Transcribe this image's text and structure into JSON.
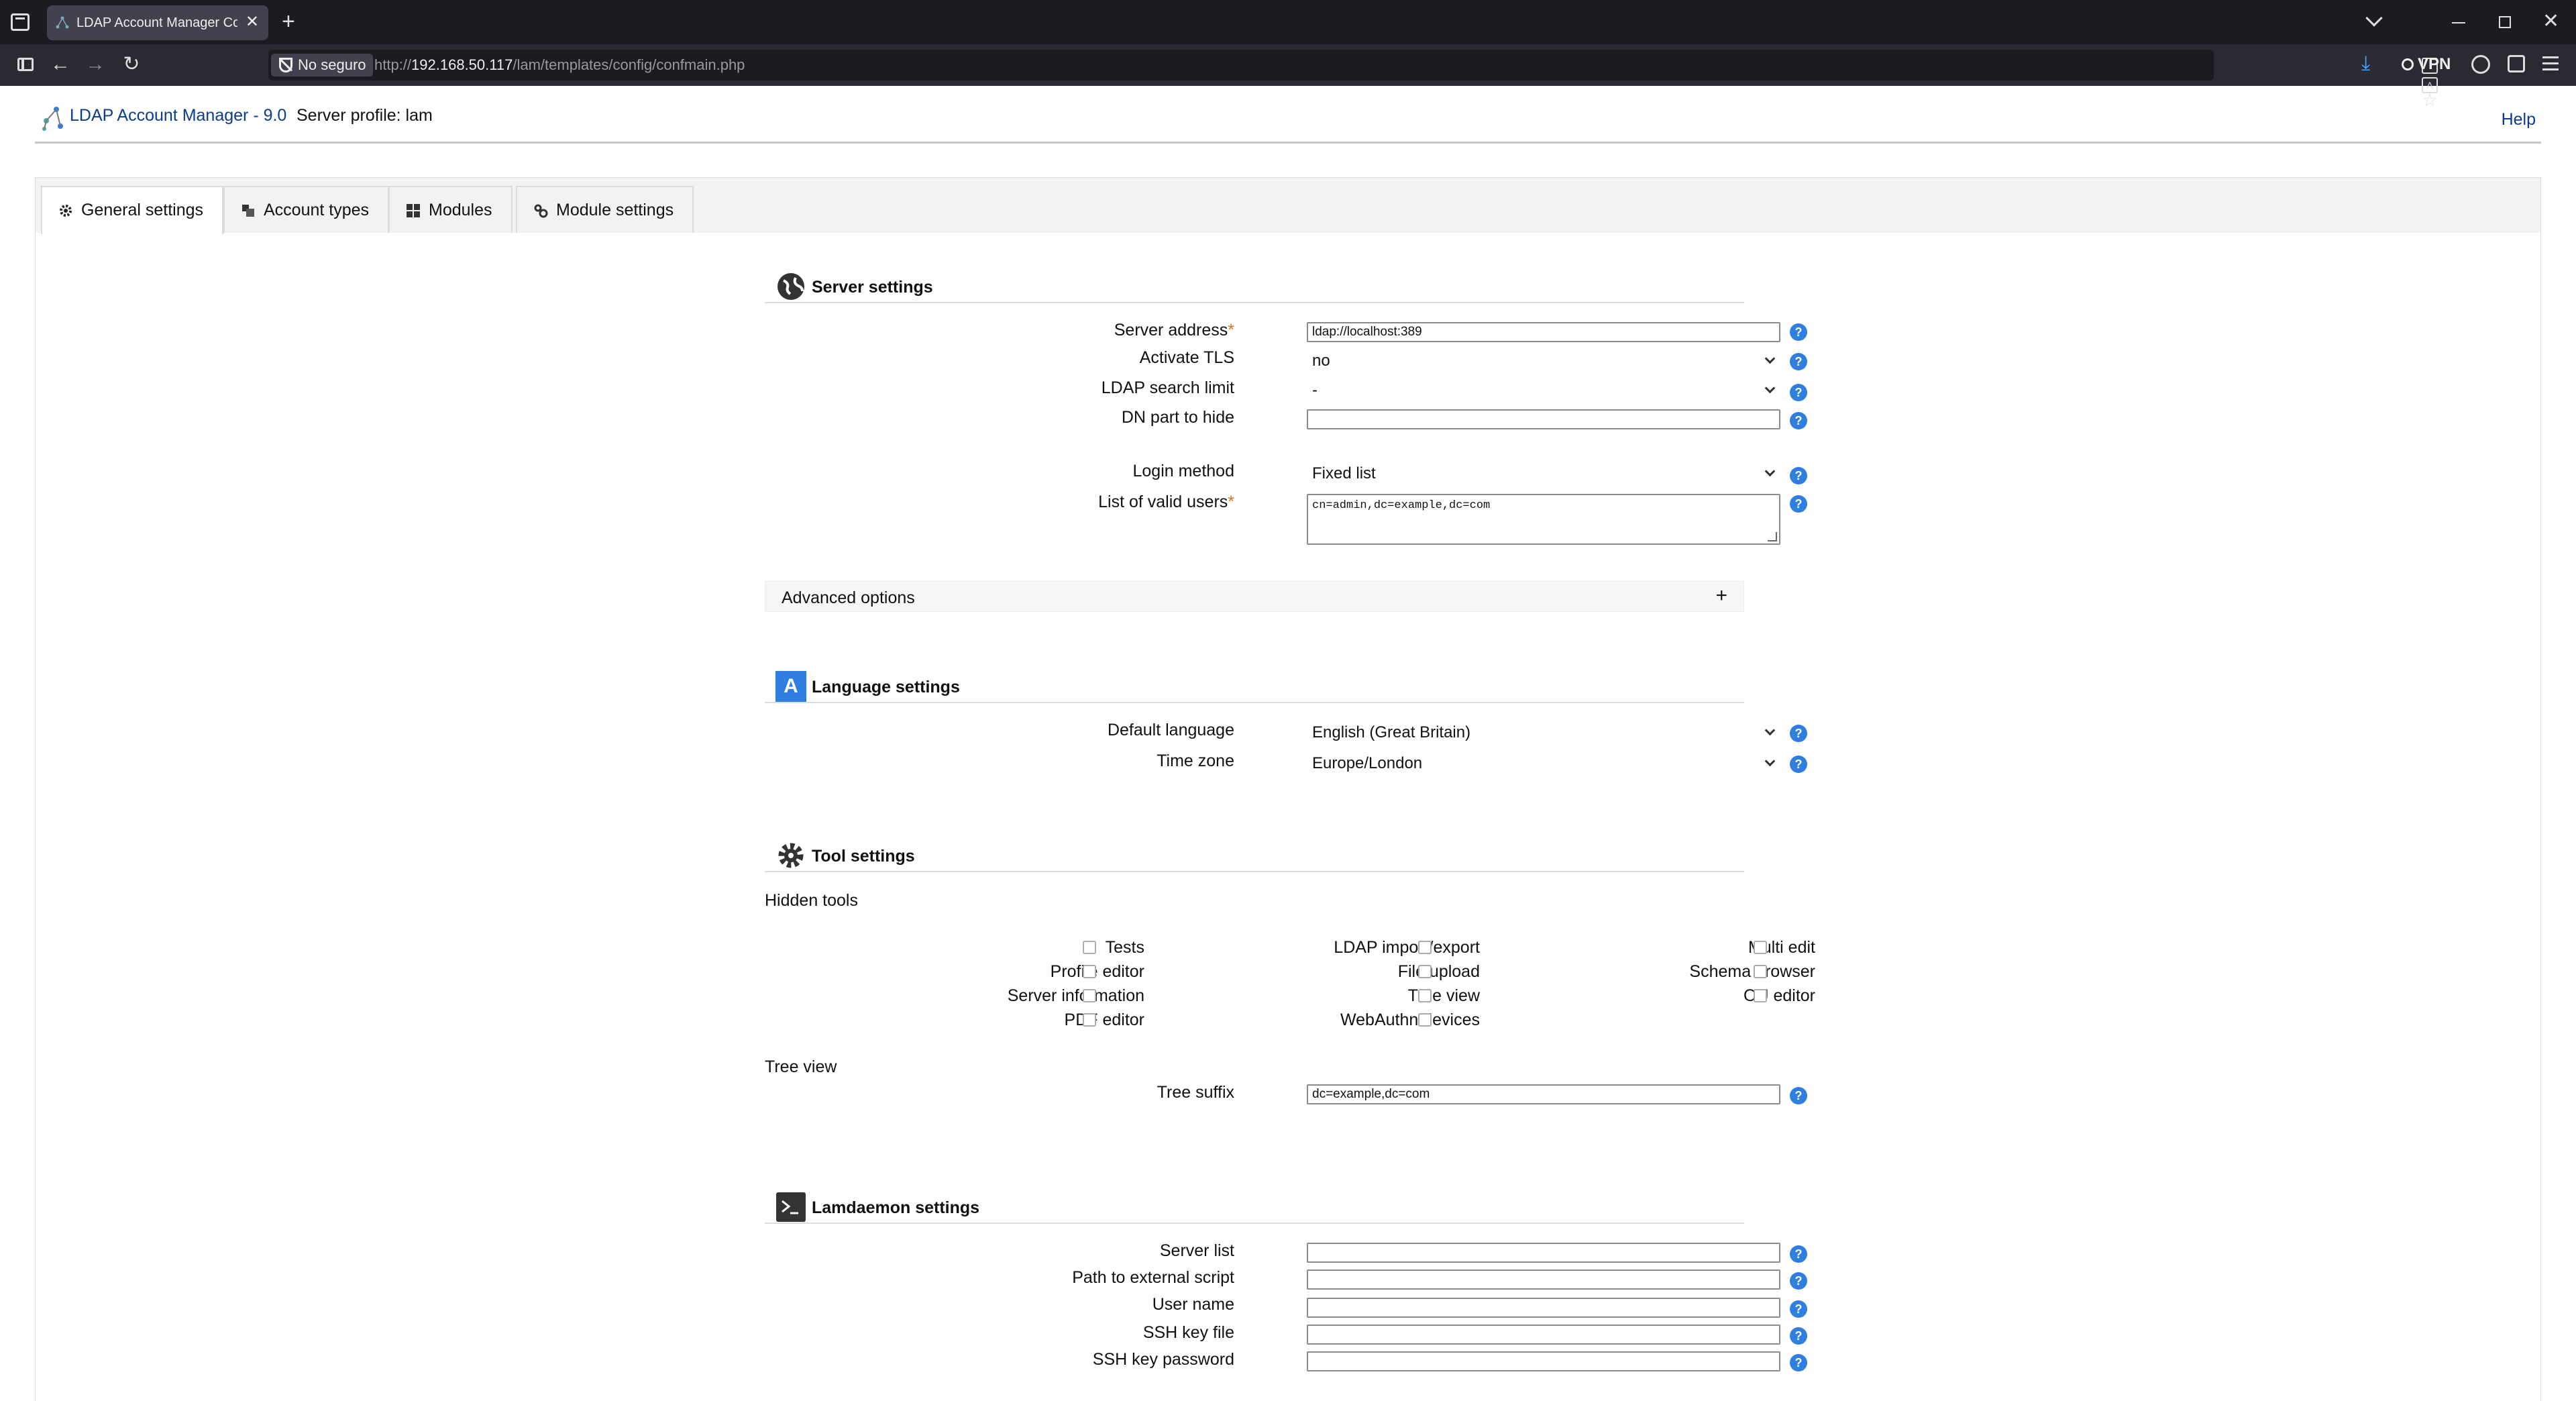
{
  "browser": {
    "tab_title": "LDAP Account Manager Configuration",
    "tab_close": "✕",
    "new_tab": "+",
    "security_label": "No seguro",
    "url_prefix": "http://",
    "url_host": "192.168.50.117",
    "url_path": "/lam/templates/config/confmain.php",
    "vpn_label": "VPN",
    "icons": [
      "reader-view-icon",
      "translate-icon",
      "bookmark-star-icon",
      "download-icon",
      "account-icon",
      "extensions-icon",
      "menu-icon"
    ]
  },
  "header": {
    "app_title": "LDAP Account Manager - 9.0",
    "server_profile": "Server profile: lam",
    "help": "Help"
  },
  "tabs": [
    {
      "label": "General settings",
      "icon": "gear-icon",
      "active": true
    },
    {
      "label": "Account types",
      "icon": "account-types-icon",
      "active": false
    },
    {
      "label": "Modules",
      "icon": "modules-grid-icon",
      "active": false
    },
    {
      "label": "Module settings",
      "icon": "module-settings-icon",
      "active": false
    }
  ],
  "server_settings": {
    "title": "Server settings",
    "server_address_label": "Server address",
    "server_address_value": "ldap://localhost:389",
    "activate_tls_label": "Activate TLS",
    "activate_tls_value": "no",
    "search_limit_label": "LDAP search limit",
    "search_limit_value": "-",
    "dn_hide_label": "DN part to hide",
    "dn_hide_value": "",
    "login_method_label": "Login method",
    "login_method_value": "Fixed list",
    "valid_users_label": "List of valid users",
    "valid_users_value": "cn=admin,dc=example,dc=com",
    "required_mark": "*",
    "advanced_label": "Advanced options",
    "advanced_toggle": "+"
  },
  "language_settings": {
    "title": "Language settings",
    "icon_letter": "A",
    "default_language_label": "Default language",
    "default_language_value": "English (Great Britain)",
    "time_zone_label": "Time zone",
    "time_zone_value": "Europe/London"
  },
  "tool_settings": {
    "title": "Tool settings",
    "hidden_tools_label": "Hidden tools",
    "col1": [
      "Tests",
      "Profile editor",
      "Server information",
      "PDF editor"
    ],
    "col2": [
      "LDAP import/export",
      "File upload",
      "Tree view",
      "WebAuthn devices"
    ],
    "col3": [
      "Multi edit",
      "Schema browser",
      "OU editor"
    ],
    "tree_view_label": "Tree view",
    "tree_suffix_label": "Tree suffix",
    "tree_suffix_value": "dc=example,dc=com"
  },
  "lamdaemon_settings": {
    "title": "Lamdaemon settings",
    "server_list_label": "Server list",
    "script_path_label": "Path to external script",
    "user_name_label": "User name",
    "ssh_key_file_label": "SSH key file",
    "ssh_key_password_label": "SSH key password"
  },
  "help_glyph": "?"
}
